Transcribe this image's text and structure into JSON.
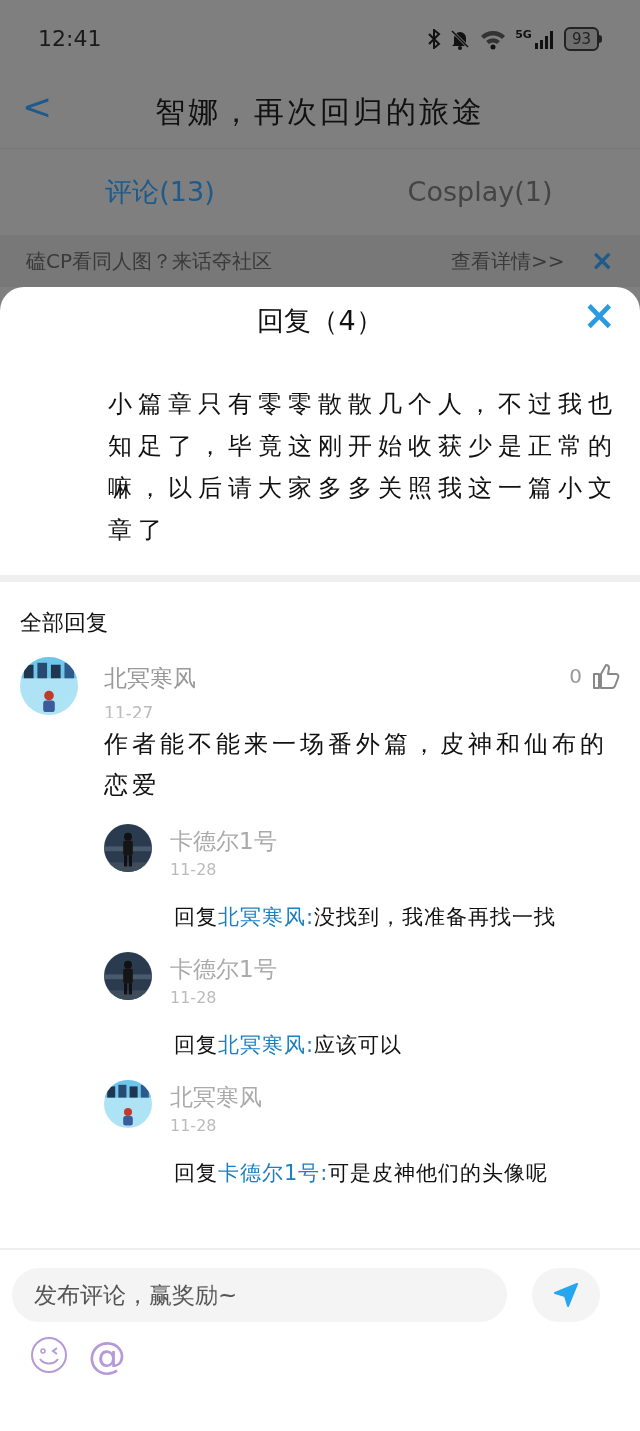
{
  "status_bar": {
    "time": "12:41",
    "network": "5G",
    "battery": "93"
  },
  "header": {
    "back": "<",
    "title": "智娜，再次回归的旅途"
  },
  "tabs": [
    {
      "label": "评论(13)",
      "selected": true
    },
    {
      "label": "Cosplay(1)",
      "selected": false
    }
  ],
  "banner": {
    "text": "磕CP看同人图？来话夺社区",
    "link": "查看详情>>",
    "close": "×"
  },
  "sheet": {
    "title": "回复（4）",
    "close": "×",
    "post_text": "小篇章只有零零散散几个人，不过我也知足了，毕竟这刚开始收获少是正常的嘛，以后请大家多多关照我这一篇小文章了",
    "section_title": "全部回复",
    "comment": {
      "author": "北冥寒风",
      "likes": "0",
      "date": "11-27",
      "text": "作者能不能来一场番外篇，皮神和仙布的恋爱"
    },
    "replies": [
      {
        "author": "卡德尔1号",
        "date": "11-28",
        "prefix": "回复",
        "target": "北冥寒风:",
        "text": "没找到，我准备再找一找"
      },
      {
        "author": "卡德尔1号",
        "date": "11-28",
        "prefix": "回复",
        "target": "北冥寒风:",
        "text": "应该可以"
      },
      {
        "author": "北冥寒风",
        "date": "11-28",
        "prefix": "回复",
        "target": "卡德尔1号:",
        "text": "可是皮神他们的头像呢"
      }
    ]
  },
  "composer": {
    "placeholder": "发布评论，赢奖励~",
    "mention": "@"
  }
}
